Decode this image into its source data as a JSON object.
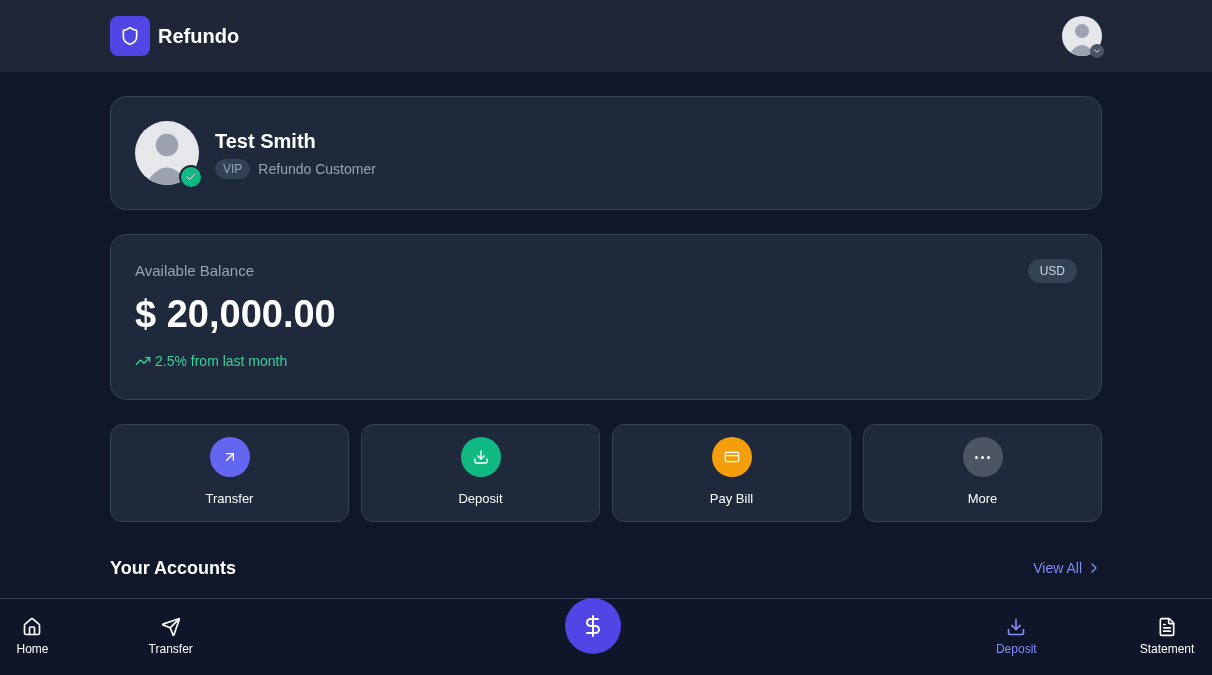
{
  "header": {
    "brand": "Refundo"
  },
  "profile": {
    "name": "Test Smith",
    "badge": "VIP",
    "subtitle": "Refundo Customer",
    "verified": true
  },
  "balance": {
    "label": "Available Balance",
    "currency": "USD",
    "amount": "$ 20,000.00",
    "change": "2.5% from last month"
  },
  "actions": [
    {
      "label": "Transfer",
      "kind": "transfer",
      "color": "#6366f1"
    },
    {
      "label": "Deposit",
      "kind": "deposit",
      "color": "#10b981"
    },
    {
      "label": "Pay Bill",
      "kind": "bill",
      "color": "#f59e0b"
    },
    {
      "label": "More",
      "kind": "more",
      "color": "#4b5563"
    }
  ],
  "accounts": {
    "title": "Your Accounts",
    "link": "View All"
  },
  "bottom_nav": [
    {
      "label": "Home",
      "kind": "home",
      "selected": false
    },
    {
      "label": "Transfer",
      "kind": "send",
      "selected": false
    },
    {
      "kind": "dollar",
      "selected": false
    },
    {
      "label": "Deposit",
      "kind": "deposit",
      "selected": true
    },
    {
      "label": "Statement",
      "kind": "statement",
      "selected": false
    }
  ]
}
